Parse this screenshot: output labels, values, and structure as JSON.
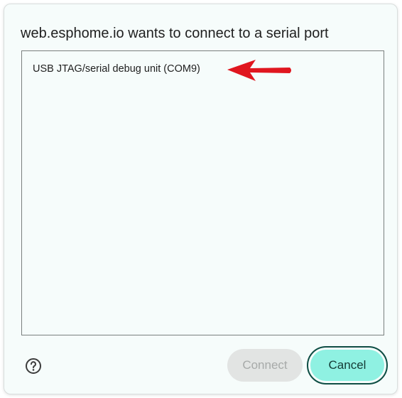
{
  "dialog": {
    "title": "web.esphome.io wants to connect to a serial port",
    "ports": [
      {
        "label": "USB JTAG/serial debug unit (COM9)"
      }
    ],
    "annotation_arrow_color": "#e0161f",
    "help_icon": "question-circle-icon",
    "buttons": {
      "connect_label": "Connect",
      "cancel_label": "Cancel"
    },
    "colors": {
      "background": "#f6fcfb",
      "cancel_fill": "#8ff1e2",
      "cancel_border": "#0f4d44",
      "connect_disabled_fill": "#e2e4e3",
      "connect_disabled_text": "#a7aaa9"
    }
  }
}
